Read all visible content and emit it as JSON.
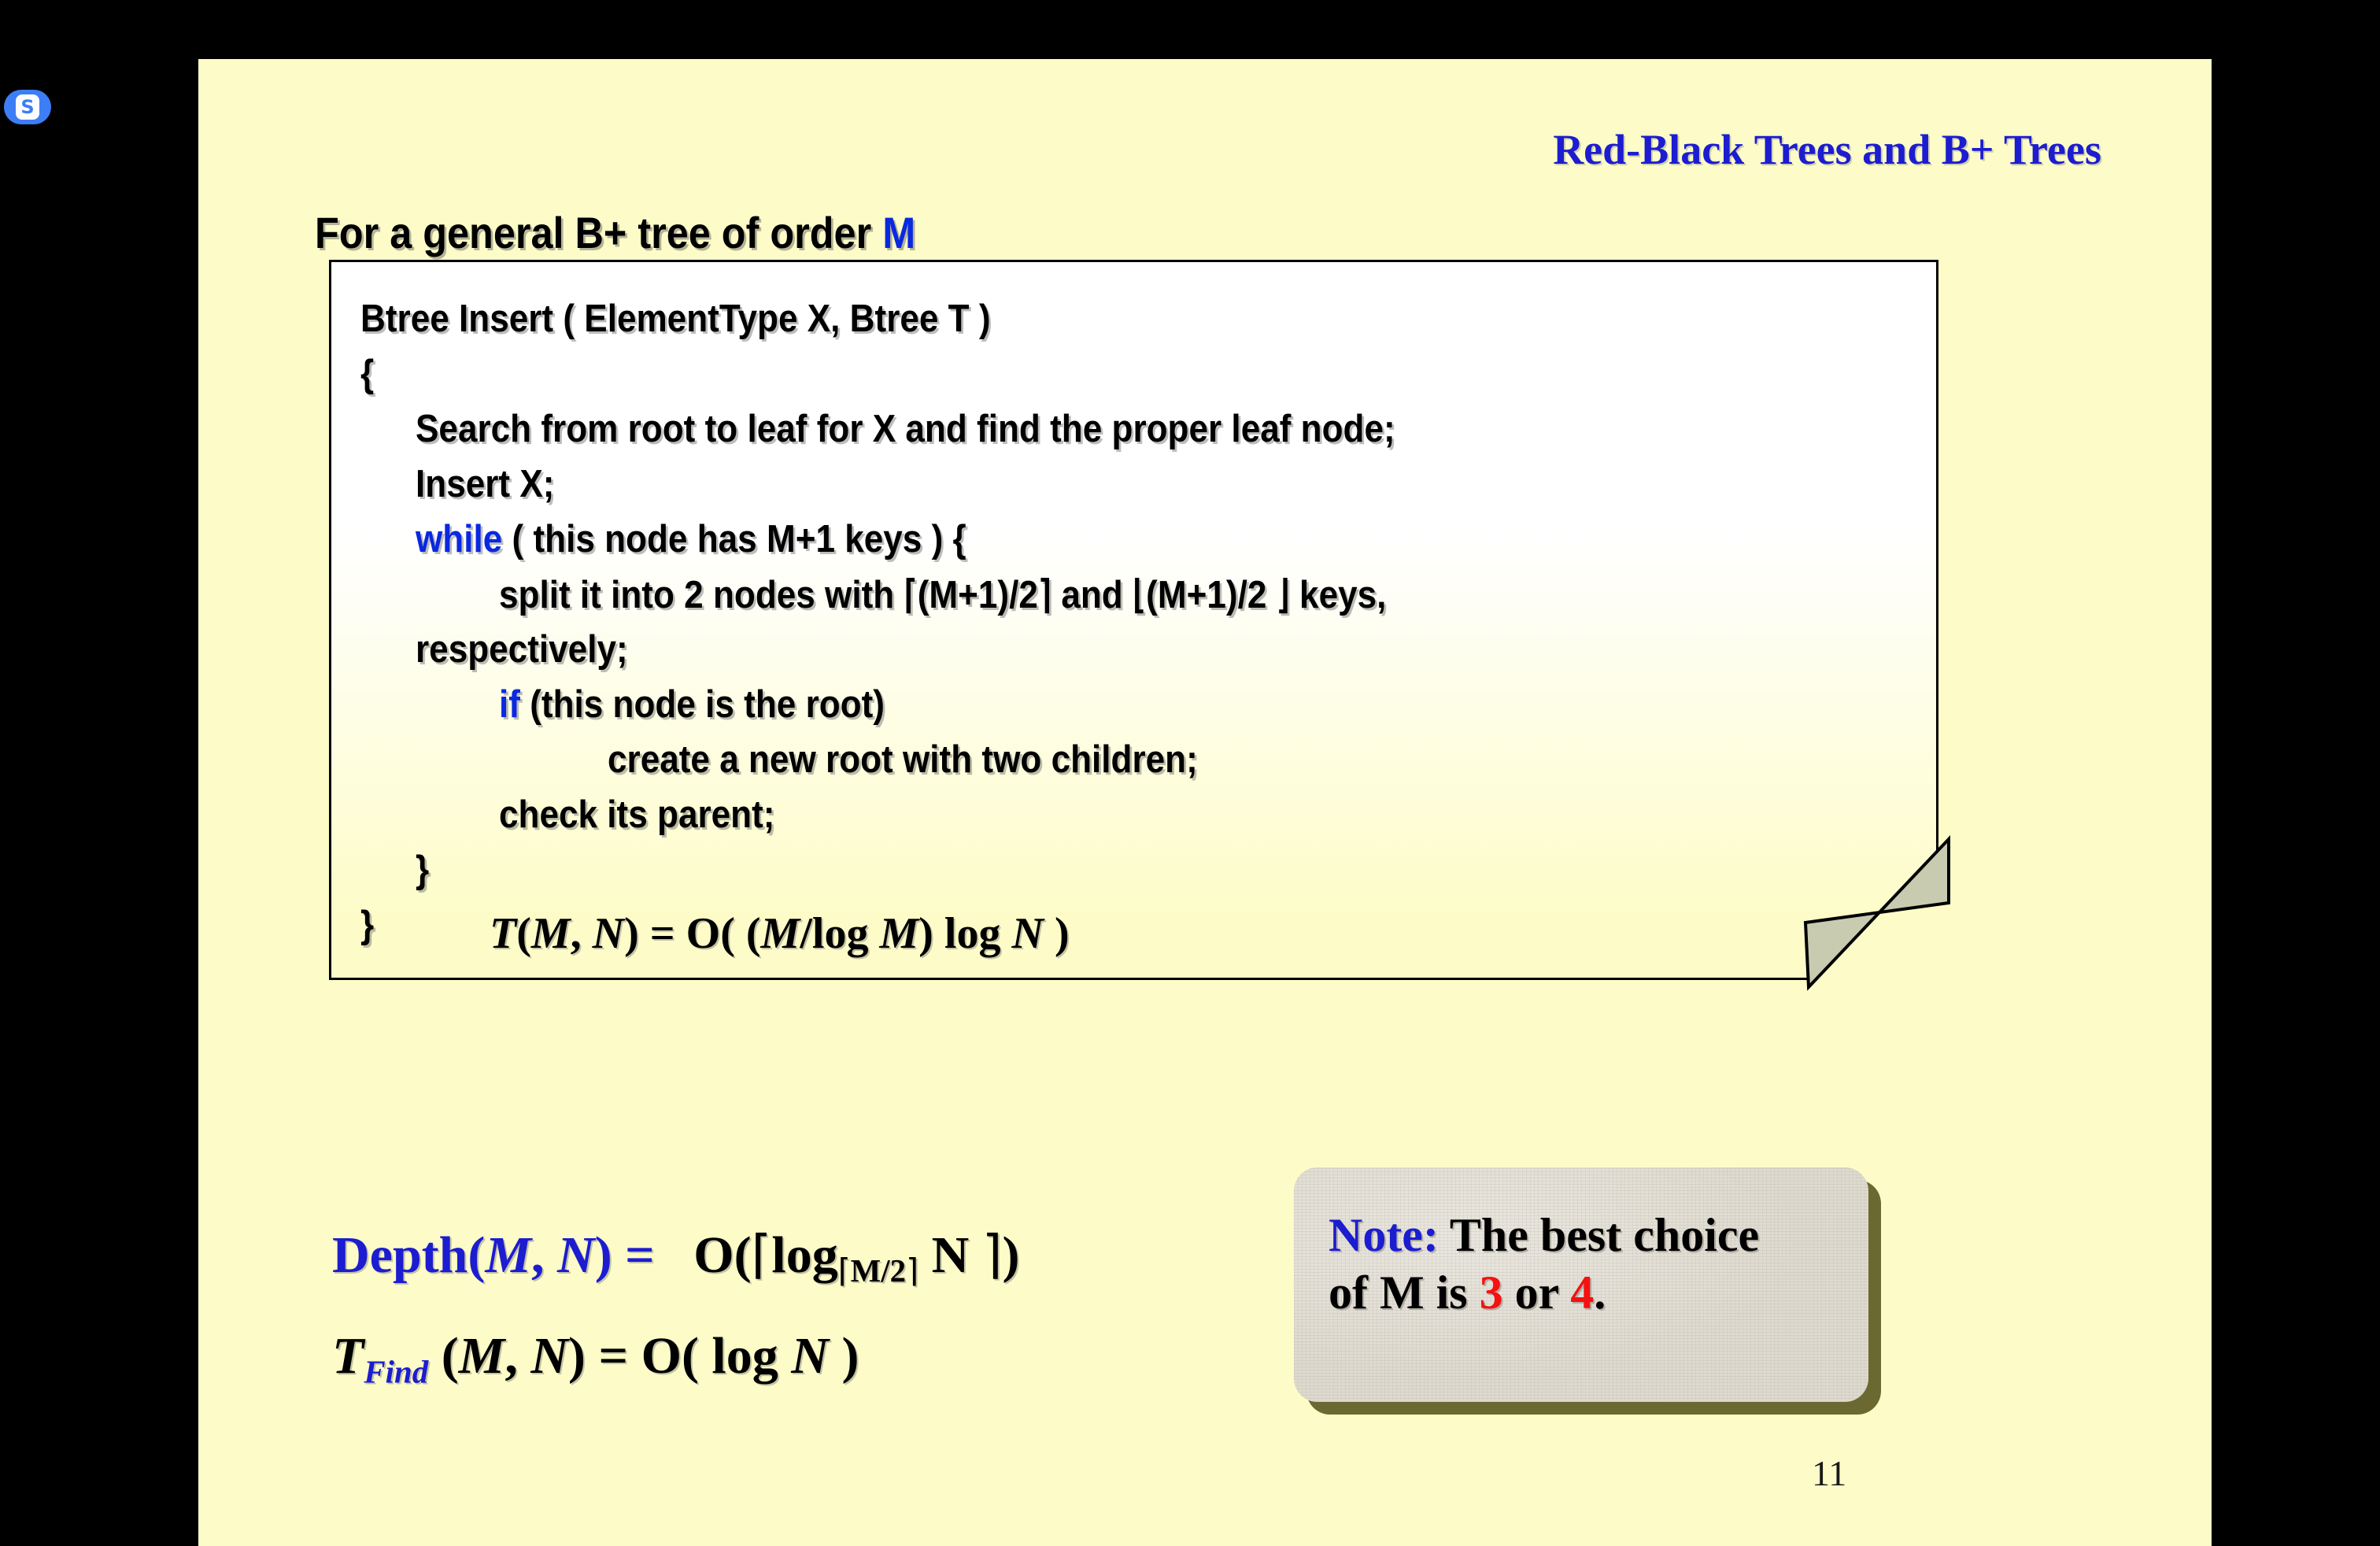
{
  "app": {
    "badge_letter": "S",
    "badge_color": "#3d7ef7"
  },
  "slide": {
    "background_color": "#fdfcc8",
    "title": "Red-Black Trees and B+ Trees",
    "title_color": "#1c1cd0",
    "page_number": "11",
    "subtitle": {
      "text_before": "For a general B+ tree of order ",
      "highlight": "M",
      "highlight_color": "#0a28e0"
    },
    "code_box": {
      "lines": [
        {
          "indent": 0,
          "text": "Btree  Insert ( ElementType X,  Btree T )"
        },
        {
          "indent": 0,
          "text": "{"
        },
        {
          "indent": 1,
          "text": "Search from root to leaf for X and find the proper leaf node;"
        },
        {
          "indent": 1,
          "text": "Insert X;"
        },
        {
          "indent": 1,
          "keyword": "while",
          "text": " ( this node has M+1 keys ) {"
        },
        {
          "indent": 2,
          "text": "split it into 2 nodes with ⌈(M+1)/2⌉ and ⌊(M+1)/2 ⌋ keys,"
        },
        {
          "indent": 1,
          "text": "respectively;"
        },
        {
          "indent": 2,
          "keyword": "if",
          "text": " (this node is the root)"
        },
        {
          "indent": 3,
          "text": "create a new root with two children;"
        },
        {
          "indent": 2,
          "text": "check its parent;"
        },
        {
          "indent": 1,
          "text": "}"
        },
        {
          "indent": 0,
          "text": "}"
        }
      ],
      "keyword_color": "#0a28e0",
      "formula": "T(M, N) = O( (M/log M) log N )"
    },
    "formulas": {
      "depth_label": "Depth(M, N) = ",
      "depth_value": "O(⌈log⌈M/2⌉ N ⌉)",
      "tfind_label": "TFind (M, N) = ",
      "tfind_value": "O( log N )",
      "label_color": "#1c1cd0"
    },
    "note": {
      "label": "Note:",
      "label_color": "#1c1cd0",
      "line1_rest": " The best choice",
      "line2_prefix": "of M is ",
      "value_a": "3",
      "line2_middle": " or ",
      "value_b": "4",
      "line2_suffix": ".",
      "value_color": "#f41111",
      "background_color": "#dedacf",
      "shadow_color": "#6b6832"
    }
  }
}
